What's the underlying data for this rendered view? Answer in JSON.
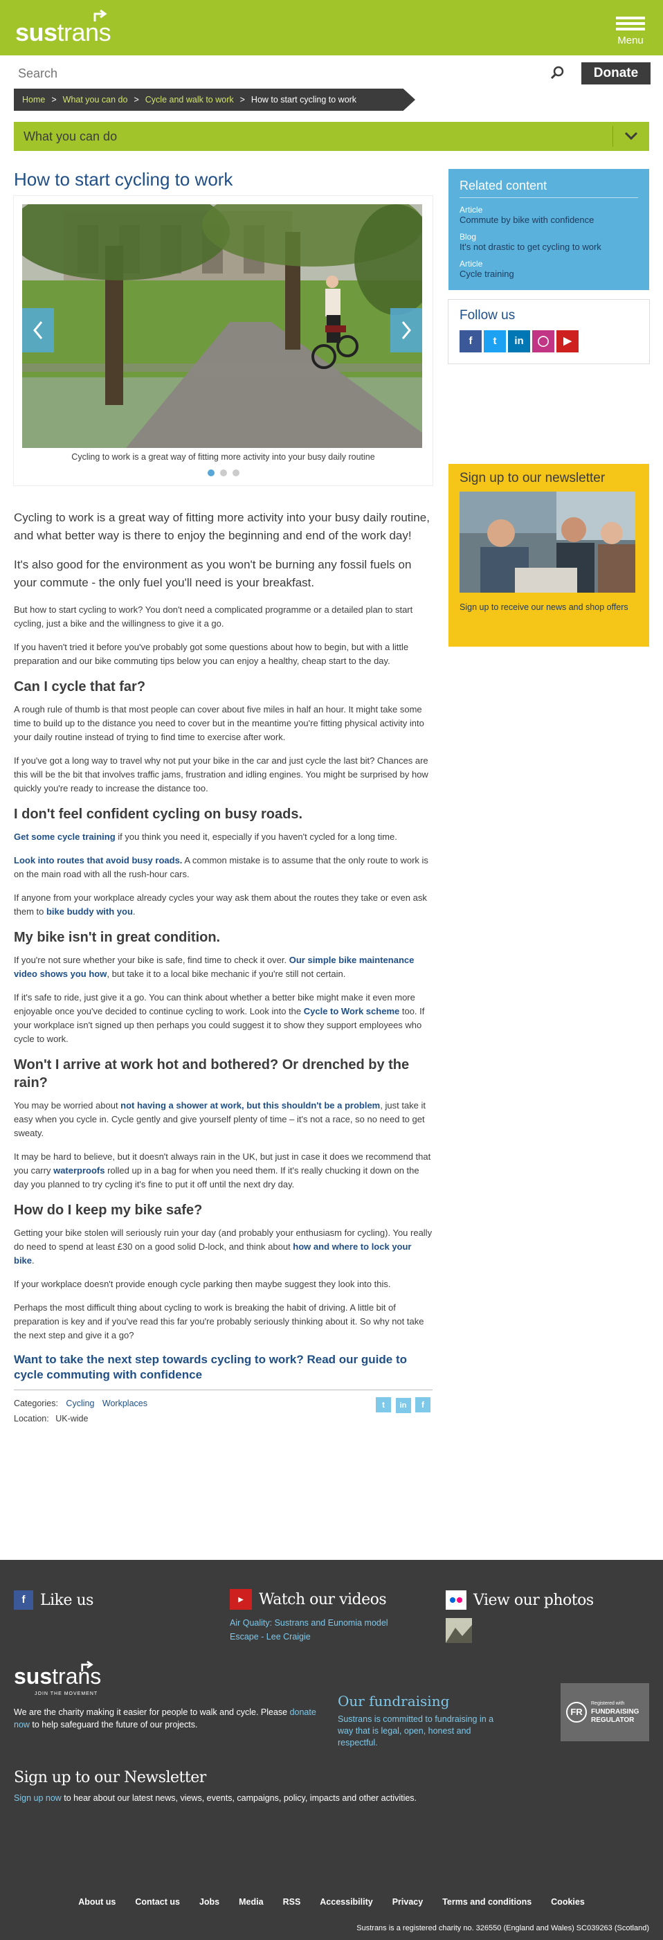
{
  "header": {
    "logo_bold": "sus",
    "logo_rest": "trans",
    "menu_label": "Menu",
    "search_placeholder": "Search",
    "donate_label": "Donate",
    "colors": {
      "brand": "#a1c42a",
      "dark": "#3c3c3c",
      "link": "#1f4f86",
      "accent": "#59b1dc",
      "newsletter": "#f5c518"
    }
  },
  "breadcrumb": {
    "items": [
      "Home",
      "What you can do",
      "Cycle and walk to work"
    ],
    "current": "How to start cycling to work",
    "separator": ">"
  },
  "section_nav": {
    "label": "What you can do",
    "icon": "chevron-down-icon"
  },
  "article": {
    "title": "How to start cycling to work",
    "slider": {
      "caption": "Cycling to work is a great way of fitting more activity into your busy daily routine",
      "slide_count": 3,
      "active_slide": 1
    },
    "lead1": "Cycling to work is a great way of fitting more activity into your busy daily routine, and what better way is there to enjoy the beginning and end of the work day!",
    "lead2": "It's also good for the environment as you won't be burning any fossil fuels on your commute - the only fuel you'll need is your breakfast.",
    "p1": "But how to start cycling to work? You don't need a complicated programme or a detailed plan to start cycling, just a bike and the willingness to give it a go.",
    "p2": "If you haven't tried it before you've probably got some questions about how to begin, but with a little preparation and our bike commuting tips below you can enjoy a healthy, cheap start to the day.",
    "h_far": "Can I cycle that far?",
    "p_far1": "A rough rule of thumb is that most people can cover about five miles in half an hour. It might take some time to build up to the distance you need to cover but in the meantime you're fitting physical activity into your daily routine instead of trying to find time to exercise after work.",
    "p_far2": "If you've got a long way to travel why not put your bike in the car and just cycle the last bit? Chances are this will be the bit that involves traffic jams, frustration and idling engines. You might be surprised by how quickly you're ready to increase the distance too.",
    "h_conf": "I don't feel confident cycling on busy roads.",
    "conf1_link": "Get some cycle training",
    "conf1_rest": " if you think you need it, especially if you haven't cycled for a long time.",
    "conf2_link": "Look into routes that avoid busy roads.",
    "conf2_rest": " A common mistake is to assume that the only route to work is on the main road with all the rush-hour cars.",
    "conf3_a": "If anyone from your workplace already cycles your way ask them about the routes they take or even ask them to ",
    "conf3_link": "bike buddy with you",
    "conf3_b": ".",
    "h_cond": "My bike isn't in great condition.",
    "cond1_a": "If you're not sure whether your bike is safe, find time to check it over. ",
    "cond1_link": "Our simple bike maintenance video shows you how",
    "cond1_b": ", but take it to a local bike mechanic if you're still not certain.",
    "cond2_a": "If it's safe to ride, just give it a go. You can think about whether a better bike might make it even more enjoyable once you've decided to continue cycling to work. Look into the ",
    "cond2_link": "Cycle to Work scheme",
    "cond2_b": " too. If your workplace isn't signed up then perhaps you could suggest it to show they support employees who cycle to work.",
    "h_hot": "Won't I arrive at work hot and bothered? Or drenched by the rain?",
    "hot1_a": "You may be worried about ",
    "hot1_link": "not having a shower at work, but this shouldn't be a problem",
    "hot1_b": ", just take it easy when you cycle in. Cycle gently and give yourself plenty of time – it's not a race, so no need to get sweaty.",
    "hot2_a": "It may be hard to believe, but it doesn't always rain in the UK, but just in case it does we recommend that you carry ",
    "hot2_link": "waterproofs",
    "hot2_b": " rolled up in a bag for when you need them. If it's really chucking it down on the day you planned to try cycling it's fine to put it off until the next dry day.",
    "h_safe": "How do I keep my bike safe?",
    "safe1_a": "Getting your bike stolen will seriously ruin your day (and probably your enthusiasm for cycling). You really do need to spend at least £30 on a good solid D-lock, and think about ",
    "safe1_link": "how and where to lock your bike",
    "safe1_b": ".",
    "safe2": "If your workplace doesn't provide enough cycle parking then maybe suggest they look into this.",
    "safe3": "Perhaps the most difficult thing about cycling to work is breaking the habit of driving. A little bit of preparation is key and if you've read this far you're probably seriously thinking about it. So why not take the next step and give it a go?",
    "cta": "Want to take the next step towards cycling to work? Read our guide to cycle commuting with confidence",
    "categories_label": "Categories:",
    "categories": [
      "Cycling",
      "Workplaces"
    ],
    "location_label": "Location:",
    "location": "UK-wide",
    "share_icons": [
      "twitter-icon",
      "linkedin-icon",
      "facebook-icon"
    ]
  },
  "sidebar": {
    "related_title": "Related content",
    "related": [
      {
        "type": "Article",
        "title": "Commute by bike with confidence"
      },
      {
        "type": "Blog",
        "title": "It's not drastic to get cycling to work"
      },
      {
        "type": "Article",
        "title": "Cycle training"
      }
    ],
    "follow_title": "Follow us",
    "follow_icons": [
      "facebook-icon",
      "twitter-icon",
      "linkedin-icon",
      "instagram-icon",
      "youtube-icon"
    ],
    "newsletter_title": "Sign up to our newsletter",
    "newsletter_text": "Sign up to receive our news and shop offers"
  },
  "footer": {
    "like_us": "Like us",
    "watch_videos": "Watch our videos",
    "videos": [
      "Air Quality: Sustrans and Eunomia model",
      "Escape - Lee Craigie"
    ],
    "view_photos": "View our photos",
    "tagline": "JOIN THE MOVEMENT",
    "charity_a": "We are the charity making it easier for people to walk and cycle. Please ",
    "charity_link": "donate now",
    "charity_b": " to help safeguard the future of our projects.",
    "fundraising_title": "Our fundraising",
    "fundraising_text": "Sustrans is committed to fundraising in a way that is legal, open, honest and respectful.",
    "regulator_line1": "Registered with",
    "regulator_line2": "FUNDRAISING",
    "regulator_line3": "REGULATOR",
    "regulator_mark": "FR",
    "newsletter_title": "Sign up to our Newsletter",
    "newsletter_link": "Sign up now",
    "newsletter_rest": " to hear about our latest news, views, events, campaigns, policy, impacts and other activities.",
    "links": [
      "About us",
      "Contact us",
      "Jobs",
      "Media",
      "RSS",
      "Accessibility",
      "Privacy",
      "Terms and conditions",
      "Cookies"
    ],
    "registration": "Sustrans is a registered charity no. 326550 (England and Wales) SC039263 (Scotland)"
  }
}
